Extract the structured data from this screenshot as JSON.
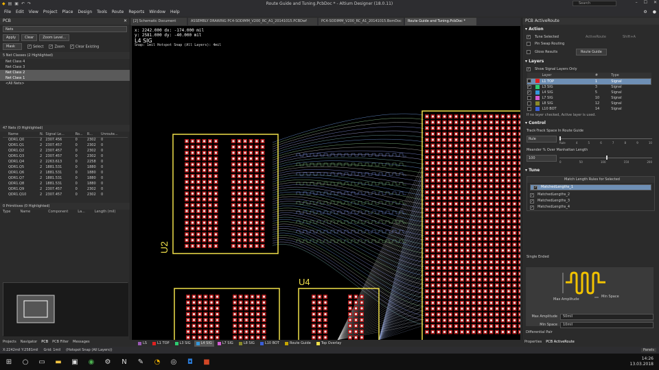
{
  "window": {
    "title": "Route Guide and Tuning.PcbDoc * - Altium Designer (18.0.11)",
    "search_placeholder": "Search",
    "controls": [
      "–",
      "☐",
      "✕"
    ]
  },
  "menu": [
    "File",
    "Edit",
    "View",
    "Project",
    "Place",
    "Design",
    "Tools",
    "Route",
    "Reports",
    "Window",
    "Help"
  ],
  "doc_tabs": [
    {
      "label": "[2] Schematic Document",
      "active": false
    },
    {
      "label": "ASSEMBLY DRAWING PC4-SODIMM_V200_RC_A1_20141015.PCBDwf",
      "active": false
    },
    {
      "label": "PC4-SODIMM_V200_RC_A1_20141015.BomDoc",
      "active": false
    },
    {
      "label": "Route Guide and Tuning.PcbDoc *",
      "active": true
    }
  ],
  "left_panel": {
    "title": "PCB",
    "mode": "Nets",
    "buttons": [
      "Apply",
      "Clear",
      "Zoom Level..."
    ],
    "mask": "Mask",
    "checks": [
      "Select",
      "Zoom",
      "Clear Existing"
    ],
    "net_classes_header": "5 Net Classes (2 Highlighted)",
    "net_classes": [
      {
        "name": "Net Class 4",
        "hl": false
      },
      {
        "name": "Net Class 3",
        "hl": false
      },
      {
        "name": "Net Class 2",
        "hl": true
      },
      {
        "name": "Net Class 1",
        "hl": true
      },
      {
        "name": "<All Nets>",
        "hl": false
      }
    ],
    "nets_header": "47 Nets (0 Highlighted)",
    "net_columns": [
      "Name",
      "N.",
      "Signal Le...",
      "Ro...",
      "R...",
      "Unroute..."
    ],
    "nets": [
      [
        "QDR1.Q0",
        "2",
        "2307.456",
        "0",
        "2302",
        "0"
      ],
      [
        "QDR1.Q1",
        "2",
        "2307.457",
        "0",
        "2302",
        "0"
      ],
      [
        "QDR1.Q2",
        "2",
        "2307.457",
        "0",
        "2302",
        "0"
      ],
      [
        "QDR1.Q3",
        "2",
        "2307.457",
        "0",
        "2302",
        "0"
      ],
      [
        "QDR1.Q4",
        "2",
        "2263.613",
        "0",
        "2258",
        "0"
      ],
      [
        "QDR1.Q5",
        "2",
        "1881.531",
        "0",
        "1880",
        "0"
      ],
      [
        "QDR1.Q6",
        "2",
        "1881.531",
        "0",
        "1880",
        "0"
      ],
      [
        "QDR1.Q7",
        "2",
        "1881.531",
        "0",
        "1880",
        "0"
      ],
      [
        "QDR1.Q8",
        "2",
        "1881.531",
        "0",
        "1880",
        "0"
      ],
      [
        "QDR1.Q9",
        "2",
        "2307.457",
        "0",
        "2302",
        "0"
      ],
      [
        "QDR1.Q10",
        "2",
        "2307.457",
        "0",
        "2302",
        "0"
      ]
    ],
    "primitives_header": "0 Primitives (0 Highlighted)",
    "primitive_columns": [
      "Type",
      "Name",
      "Component",
      "La...",
      "Length (mil)"
    ],
    "bottom_tabs": [
      "Projects",
      "Navigator",
      "PCB",
      "PCB Filter",
      "Messages"
    ]
  },
  "canvas": {
    "coords": [
      "x: 2242.000   dx: -174.000 mil",
      "y: 2581.000   dy:  -40.000 mil"
    ],
    "active_layer": "L4 SIG",
    "snap": "Snap: 1mil Hotspot Snap (All Layers): 4mil",
    "designators": [
      "U2",
      "U4"
    ]
  },
  "layer_tabs": [
    {
      "label": "LS",
      "color": "#9b59b6",
      "active": false
    },
    {
      "label": "L1 TOP",
      "color": "#e02020",
      "active": false
    },
    {
      "label": "L3 SIG",
      "color": "#2ecc71",
      "active": false
    },
    {
      "label": "L4 SIG",
      "color": "#3498db",
      "active": true
    },
    {
      "label": "L7 SIG",
      "color": "#d35cd3",
      "active": false
    },
    {
      "label": "L8 SIG",
      "color": "#8a8a2a",
      "active": false
    },
    {
      "label": "L10 BOT",
      "color": "#3a5fd9",
      "active": false
    },
    {
      "label": "Route Guide",
      "color": "#c7a600",
      "active": false
    },
    {
      "label": "Top Overlay",
      "color": "#f1e14a",
      "active": false
    }
  ],
  "right_panel": {
    "title": "PCB ActiveRoute",
    "action_header": "Action",
    "tune_selected": "Tune Selected",
    "activate_hint": "ActiveRoute",
    "shortcut_hint": "Shift+A",
    "pin_swap": "Pin Swap Routing",
    "gloss": "Gloss Results",
    "route_guide_btn": "Route Guide",
    "layers_header": "Layers",
    "show_signal": "Show Signal Layers Only",
    "layer_columns": [
      "Layer",
      "#",
      "Type"
    ],
    "layers": [
      {
        "name": "L1 TOP",
        "num": "1",
        "type": "Signal",
        "color": "#e02020",
        "checked": false,
        "sel": true
      },
      {
        "name": "L3 SIG",
        "num": "3",
        "type": "Signal",
        "color": "#2ecc71",
        "checked": true,
        "sel": false
      },
      {
        "name": "L4 SIG",
        "num": "5",
        "type": "Signal",
        "color": "#3498db",
        "checked": true,
        "sel": false
      },
      {
        "name": "L7 SIG",
        "num": "10",
        "type": "Signal",
        "color": "#d35cd3",
        "checked": false,
        "sel": false
      },
      {
        "name": "L8 SIG",
        "num": "12",
        "type": "Signal",
        "color": "#8a8a2a",
        "checked": false,
        "sel": false
      },
      {
        "name": "L10 BOT",
        "num": "14",
        "type": "Signal",
        "color": "#3a5fd9",
        "checked": false,
        "sel": false
      }
    ],
    "layer_note": "If no layer checked, Active layer is used.",
    "control_header": "Control",
    "track_space_label": "Track-Track Space In Route Guide",
    "track_space_value": "Rule",
    "track_ticks": [
      "Rule",
      "4",
      "5",
      "6",
      "7",
      "8",
      "9",
      "10"
    ],
    "meander_label": "Meander % Over Manhattan Length",
    "meander_value": "100",
    "meander_ticks": [
      "0",
      "50",
      "100",
      "150",
      "200"
    ],
    "meander_level": 100,
    "tune_header": "Tune",
    "match_header": "Match Length Rules for Selected",
    "rules": [
      {
        "name": "MatchedLengths_1",
        "sel": true
      },
      {
        "name": "MatchedLengths_2",
        "sel": false
      },
      {
        "name": "MatchedLengths_3",
        "sel": false
      },
      {
        "name": "MatchedLengths_4",
        "sel": false
      }
    ],
    "single_ended": "Single Ended",
    "max_amp_label": "Max Amplitude",
    "min_space_label": "Min Space",
    "max_amp_value": "50mil",
    "min_space_value": "10mil",
    "diff_pair": "Differential Pair",
    "bottom_tabs": [
      "Properties",
      "PCB ActiveRoute"
    ]
  },
  "status": {
    "pos": "X:2242mil Y:2581mil",
    "grid": "Grid: 1mil",
    "snap": "(Hotspot Snap (All Layers))",
    "panels": "Panels"
  },
  "taskbar": {
    "time": "14:26",
    "date": "13.03.2018"
  }
}
